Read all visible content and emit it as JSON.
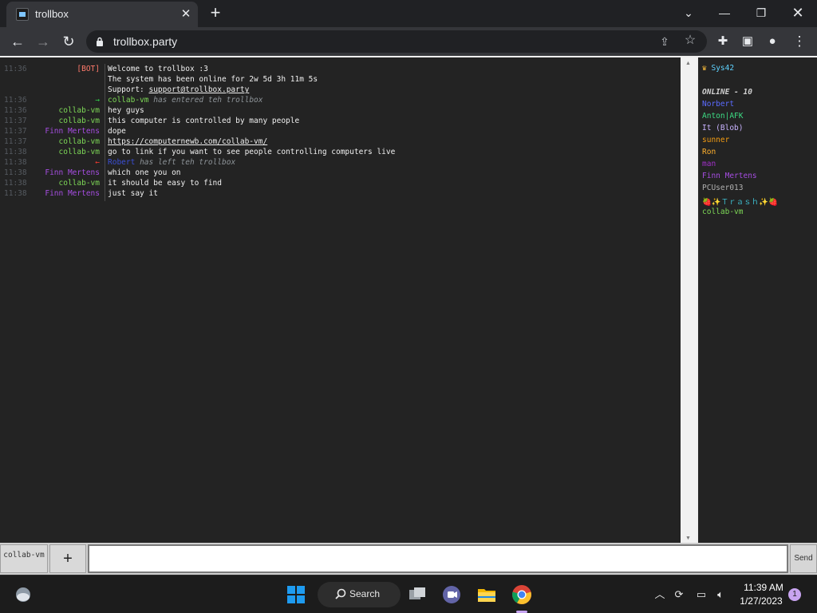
{
  "browser": {
    "tab_title": "trollbox",
    "tab_close": "✕",
    "new_tab": "+",
    "url": "trollbox.party"
  },
  "chat": {
    "messages": [
      {
        "time": "11:36",
        "nick": "[BOT]",
        "nick_color": "#ff7a6b",
        "text": "Welcome to trollbox :3"
      },
      {
        "time": "",
        "nick": "",
        "nick_color": "#ffffff",
        "text": "The system has been online for 2w 5d 3h 11m 5s"
      },
      {
        "time": "",
        "nick": "",
        "nick_color": "#ffffff",
        "text_prefix": "Support: ",
        "link": "support@trollbox.party"
      },
      {
        "time": "11:36",
        "nick": "→",
        "nick_color": "#32d74b",
        "join_user": "collab-vm",
        "join_user_color": "#7ed957",
        "event": "has entered teh trollbox"
      },
      {
        "time": "11:36",
        "nick": "collab-vm",
        "nick_color": "#7ed957",
        "text": "hey guys"
      },
      {
        "time": "11:37",
        "nick": "collab-vm",
        "nick_color": "#7ed957",
        "text": "this computer is controlled by many people"
      },
      {
        "time": "11:37",
        "nick": "Finn Mertens",
        "nick_color": "#a54de0",
        "text": "dope"
      },
      {
        "time": "11:37",
        "nick": "collab-vm",
        "nick_color": "#7ed957",
        "link": "https://computernewb.com/collab-vm/"
      },
      {
        "time": "11:38",
        "nick": "collab-vm",
        "nick_color": "#7ed957",
        "text": "go to link if you want to see people controlling computers live"
      },
      {
        "time": "11:38",
        "nick": "←",
        "nick_color": "#ff3b30",
        "join_user": "Robert",
        "join_user_color": "#3b4fd6",
        "event": "has left teh trollbox"
      },
      {
        "time": "11:38",
        "nick": "Finn Mertens",
        "nick_color": "#a54de0",
        "text": "which one you on"
      },
      {
        "time": "11:38",
        "nick": "collab-vm",
        "nick_color": "#7ed957",
        "text": "it should be easy to find"
      },
      {
        "time": "11:38",
        "nick": "Finn Mertens",
        "nick_color": "#a54de0",
        "text": "just say it"
      }
    ]
  },
  "users": {
    "top_user": "Sys42",
    "top_user_color": "#5fd3ff",
    "online_label": "ONLINE - 10",
    "list": [
      {
        "name": "Norbert",
        "color": "#5b6bff"
      },
      {
        "name": "Anton|AFK",
        "color": "#3ddc84"
      },
      {
        "name": "It (Blob)",
        "color": "#c9b3ff"
      },
      {
        "name": "sunner",
        "color": "#f39c12"
      },
      {
        "name": "Ron",
        "color": "#ffb02e"
      },
      {
        "name": "man",
        "color": "#a030c8"
      },
      {
        "name": "Finn Mertens",
        "color": "#a54de0"
      },
      {
        "name": "PCUser013",
        "color": "#b0b0b0"
      },
      {
        "name": "🍓✨Ｔｒａｓｈ✨🍓",
        "color": "#3db8c9"
      },
      {
        "name": "collab-vm",
        "color": "#7ed957"
      }
    ]
  },
  "input": {
    "room_tab": "collab-vm",
    "add_room": "+",
    "placeholder": "",
    "send_label": "Send"
  },
  "taskbar": {
    "search_label": "Search",
    "time": "11:39 AM",
    "date": "1/27/2023",
    "notification_count": "1"
  }
}
